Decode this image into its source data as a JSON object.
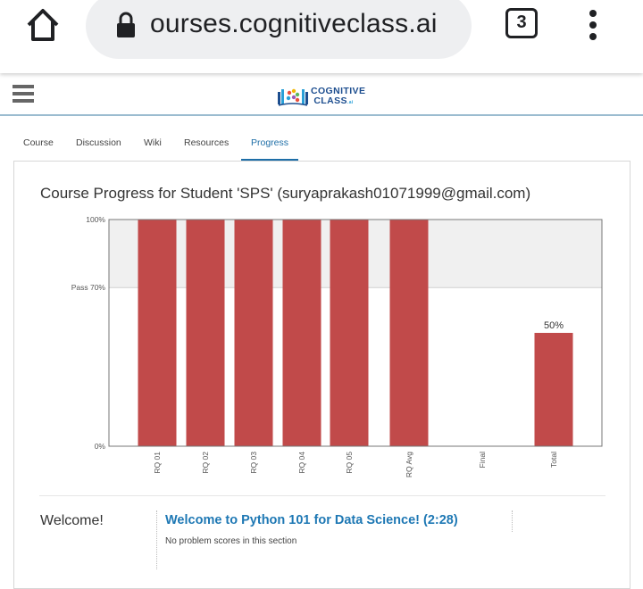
{
  "browser": {
    "url_text": "ourses.cognitiveclass.ai",
    "tab_count": "3"
  },
  "site": {
    "logo_line1": "COGNITIVE",
    "logo_line2": "CLASS",
    "logo_suffix": ".ai"
  },
  "course_nav": {
    "tabs": [
      "Course",
      "Discussion",
      "Wiki",
      "Resources",
      "Progress"
    ],
    "active": "Progress"
  },
  "page": {
    "title": "Course Progress for Student 'SPS' (suryaprakash01071999@gmail.com)"
  },
  "chart_data": {
    "type": "bar",
    "categories": [
      "RQ 01",
      "RQ 02",
      "RQ 03",
      "RQ 04",
      "RQ 05",
      "RQ Avg",
      "Final",
      "Total"
    ],
    "values": [
      100,
      100,
      100,
      100,
      100,
      100,
      0,
      50
    ],
    "ylim": [
      0,
      100
    ],
    "y_ticks": [
      {
        "value": 0,
        "label": "0%"
      },
      {
        "value": 70,
        "label": "Pass 70%"
      },
      {
        "value": 100,
        "label": "100%"
      }
    ],
    "pass_threshold": 70,
    "data_labels": {
      "Total": "50%"
    },
    "bar_color": "#c14a4a",
    "pass_band_color": "#f0f0f0"
  },
  "sections": [
    {
      "chapter": "Welcome!",
      "link": "Welcome to Python 101 for Data Science! (2:28)",
      "note": "No problem scores in this section"
    }
  ]
}
